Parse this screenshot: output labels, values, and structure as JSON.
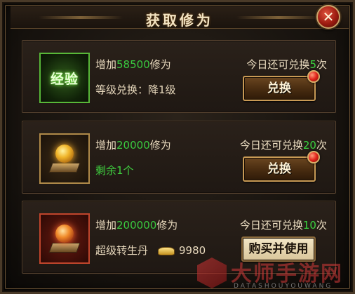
{
  "title": "获取修为",
  "close_label": "✕",
  "cards": [
    {
      "icon": "exp-badge-icon",
      "icon_text": "经验",
      "gain_prefix": "增加",
      "gain_amount": "58500",
      "gain_suffix": "修为",
      "detail": "等级兑换：降1级",
      "count_prefix": "今日还可兑换",
      "count_value": "5",
      "count_suffix": "次",
      "button_label": "兑换"
    },
    {
      "icon": "golden-orb-icon",
      "gain_prefix": "增加",
      "gain_amount": "20000",
      "gain_suffix": "修为",
      "detail": "剩余1个",
      "count_prefix": "今日还可兑换",
      "count_value": "20",
      "count_suffix": "次",
      "button_label": "兑换"
    },
    {
      "icon": "red-orb-icon",
      "gain_prefix": "增加",
      "gain_amount": "200000",
      "gain_suffix": "修为",
      "detail": "超级转生丹",
      "price": "9980",
      "count_prefix": "今日还可兑换",
      "count_value": "10",
      "count_suffix": "次",
      "button_label": "购买并使用"
    }
  ],
  "watermark": {
    "text": "大师手游网",
    "sub": "DATASHOUYOUWANG"
  },
  "colors": {
    "highlight_green": "#39c93f",
    "button_gold_border": "#c89a55",
    "badge_red": "#e0231a"
  }
}
